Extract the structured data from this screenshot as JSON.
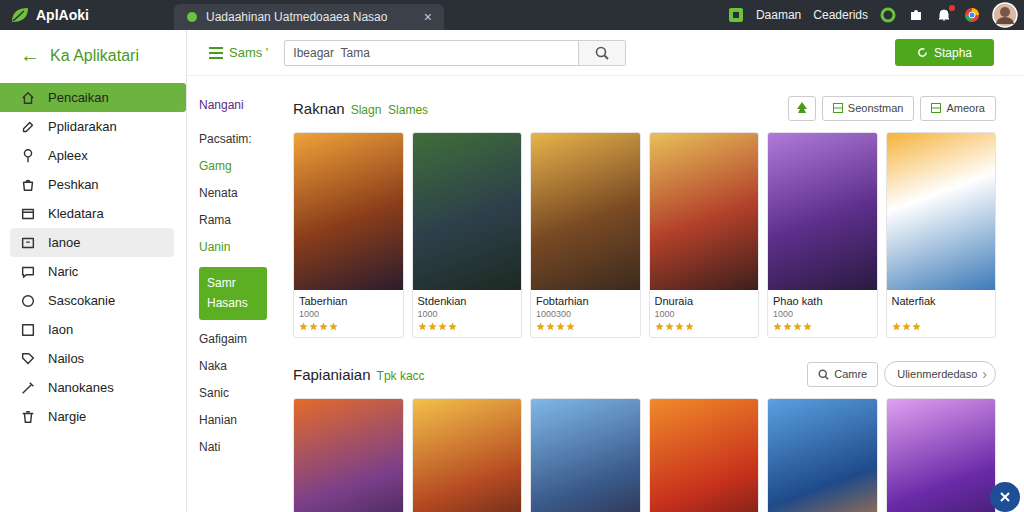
{
  "topbar": {
    "logo": "AplAoki",
    "tab": {
      "title": "Uadaahinan Uatmedoaaea Nasao",
      "close": "×"
    },
    "links": [
      "Daaman",
      "Ceaderids"
    ],
    "notification_dot": true
  },
  "sidebar": {
    "back": "←",
    "title": "Ka Aplikatari",
    "items": [
      {
        "label": "Pencaikan",
        "selected": true,
        "hovered": false
      },
      {
        "label": "Pplidarakan",
        "selected": false,
        "hovered": false
      },
      {
        "label": "Apleex",
        "selected": false,
        "hovered": false
      },
      {
        "label": "Peshkan",
        "selected": false,
        "hovered": false
      },
      {
        "label": "Kledatara",
        "selected": false,
        "hovered": false
      },
      {
        "label": "Ianoe",
        "selected": false,
        "hovered": true
      },
      {
        "label": "Naric",
        "selected": false,
        "hovered": false
      },
      {
        "label": "Sascokanie",
        "selected": false,
        "hovered": false
      },
      {
        "label": "Iaon",
        "selected": false,
        "hovered": false
      },
      {
        "label": "Nailos",
        "selected": false,
        "hovered": false
      },
      {
        "label": "Nanokanes",
        "selected": false,
        "hovered": false
      },
      {
        "label": "Nargie",
        "selected": false,
        "hovered": false
      }
    ]
  },
  "toolbar": {
    "menu_label": "Sams '",
    "search": {
      "placeholder": "Ibeagar  Tama"
    },
    "button": "Stapha"
  },
  "categories": {
    "heading": "Nangani",
    "items": [
      {
        "label": "Pacsatim:",
        "selected": false,
        "accent": false
      },
      {
        "label": "Gamg",
        "selected": false,
        "accent": true
      },
      {
        "label": "Nenata",
        "selected": false,
        "accent": false
      },
      {
        "label": "Rama",
        "selected": false,
        "accent": false
      },
      {
        "label": "Uanin",
        "selected": false,
        "accent": true
      },
      {
        "label": "Samr Hasans",
        "selected": true,
        "accent": false
      },
      {
        "label": "Gafigaim",
        "selected": false,
        "accent": false
      },
      {
        "label": "Naka",
        "selected": false,
        "accent": false
      },
      {
        "label": "Sanic",
        "selected": false,
        "accent": false
      },
      {
        "label": "Hanian",
        "selected": false,
        "accent": false
      },
      {
        "label": "Nati",
        "selected": false,
        "accent": false
      }
    ]
  },
  "sections": [
    {
      "title": "Raknan",
      "subtitle": "Slagn  Slames",
      "actions": [
        {
          "kind": "icon"
        },
        {
          "kind": "button",
          "label": "Seonstman"
        },
        {
          "kind": "button",
          "label": "Ameora"
        }
      ],
      "cards": [
        {
          "title": "Taberhian",
          "price": "1000",
          "stars": 4
        },
        {
          "title": "Stdenkian",
          "price": "1000",
          "stars": 4
        },
        {
          "title": "Fobtarhian",
          "price": "1000300",
          "stars": 4
        },
        {
          "title": "Dnuraia",
          "price": "1000",
          "stars": 4
        },
        {
          "title": "Phao kath",
          "price": "1000",
          "stars": 4
        },
        {
          "title": "Naterfiak",
          "price": "",
          "stars": 3
        }
      ]
    },
    {
      "title": "Fapianiaian",
      "subtitle": "Tpk kacc",
      "actions": [
        {
          "kind": "search",
          "label": "Camre"
        },
        {
          "kind": "dropdown",
          "label": "Ulienmerdedaso",
          "arrow": "›"
        }
      ],
      "cards": [
        {},
        {},
        {},
        {},
        {},
        {}
      ]
    }
  ]
}
